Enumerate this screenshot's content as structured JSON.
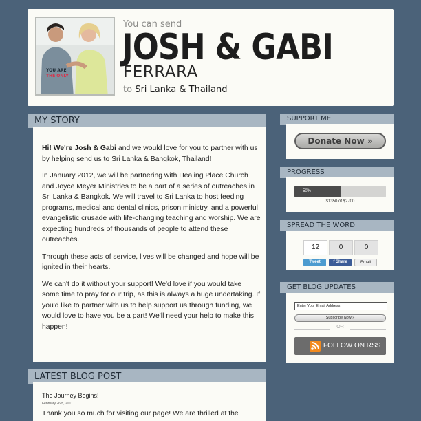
{
  "header": {
    "intro": "You can send",
    "names": "JOSH & GABI",
    "surname": "FERRARA",
    "to_word": "to",
    "destination": "Sri Lanka & Thailand",
    "photo_shirt_text": "YOU ARE THE ONLY"
  },
  "story": {
    "heading": "MY STORY",
    "greeting_bold": "Hi! We're Josh & Gabi",
    "greeting_rest": " and we would love for you to partner with us by helping send us to Sri Lanka & Bangkok, Thailand!",
    "paragraph2": "In January 2012, we will be partnering with Healing Place Church and Joyce Meyer Ministries to be a part of a series of outreaches in Sri Lanka & Bangkok. We will travel to Sri Lanka to host feeding programs, medical and dental clinics, prison ministry, and a powerful evangelistic crusade with life-changing teaching and worship. We are expecting hundreds of thousands of people to attend these outreaches.",
    "paragraph3": "Through these acts of service, lives will be changed and hope will be ignited in their hearts.",
    "paragraph4": "We can't do it without your support! We'd love if you would take some time to pray for our trip, as this is always a huge undertaking. If you'd like to partner with us to help support us through funding, we would love to have you be a part! We'll need your help to make this happen!"
  },
  "blog": {
    "heading": "LATEST BLOG POST",
    "post_title": "The Journey Begins!",
    "post_date": "February 26th, 2011",
    "post_excerpt": "Thank you so much for visiting our page! We are thrilled at the"
  },
  "sidebar": {
    "support": {
      "heading": "SUPPORT ME",
      "button_label": "Donate Now »"
    },
    "progress": {
      "heading": "PROGRESS",
      "percent_label": "50%",
      "fraction": 0.5,
      "amount_text": "$1350 of $2700"
    },
    "spread": {
      "heading": "SPREAD THE WORD",
      "tweet_count": "12",
      "share_count": "0",
      "email_count": "0",
      "tweet_label": "Tweet",
      "share_label": "f Share",
      "email_label": "Email"
    },
    "updates": {
      "heading": "GET BLOG UPDATES",
      "email_value": "Enter Your Email Address",
      "subscribe_label": "Subscribe Now »",
      "or_label": "OR",
      "rss_label": "FOLLOW ON RSS",
      "rss_icon": "rss-icon"
    }
  },
  "colors": {
    "background": "#4b6279",
    "panel": "#fbfbf6",
    "tab": "#a8b6c2",
    "rss": "#f28a1e"
  }
}
